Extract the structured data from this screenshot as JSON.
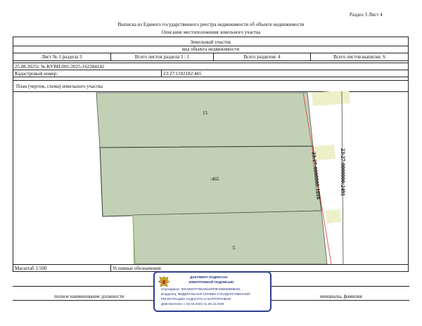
{
  "header": {
    "section_sheet": "Раздел 3   Лист 4",
    "title": "Выписка из Единого государственного реестра недвижимости об объекте недвижимости",
    "subtitle": "Описание местоположения земельного участка"
  },
  "object": {
    "type": "Земельный участок",
    "kind_label": "вид объекта недвижимости"
  },
  "sheet_info": {
    "sheet_of_section": "Лист № 1 раздела 3",
    "total_sheets_section": "Всего листов раздела 3 : 1",
    "total_sections": "Всего разделов: 4",
    "total_sheets_extract": "Всего листов выписки: 6"
  },
  "extract": {
    "date_number": "25.08.2025г. № КУВИ-001/2025-162284142",
    "cadastral_label": "Кадастровый номер:",
    "cadastral_number": "23:27:1102182:465"
  },
  "plan": {
    "title": "План (чертеж, схема) земельного участка",
    "parcel_labels": {
      "top": "15",
      "center": ":465",
      "bottom": ":5"
    },
    "road_label_1": "23:27:0000000:1016",
    "road_label_2": "23:27:0000000:2491",
    "colors": {
      "parcel_fill": "#c2d1b5",
      "road_fill": "#eef0c8",
      "red_line": "#e0504a",
      "green_edge": "#8fc070"
    }
  },
  "footer": {
    "scale": "Масштаб 1:500",
    "legend": "Условные обозначения:",
    "position_label": "полное наименование должности",
    "signature_name": "инициалы, фамилия"
  },
  "stamp": {
    "line1": "ДОКУМЕНТ ПОДПИСАН",
    "line2": "ЭЛЕКТРОННОЙ ПОДПИСЬЮ",
    "line3": "Сертификат: 00C0ED7F75D1B10DF8F35B9DB96D91…",
    "line4": "Владелец: ФЕДЕРАЛЬНАЯ СЛУЖБА ГОСУДАРСТВЕННОЙ",
    "line5": "РЕГИСТРАЦИИ, КАДАСТРА И КАРТОГРАФИИ",
    "line6": "Действителен: с 02.04.2024 по 26.12.2025",
    "emblem_icon": "russian-eagle-emblem"
  }
}
